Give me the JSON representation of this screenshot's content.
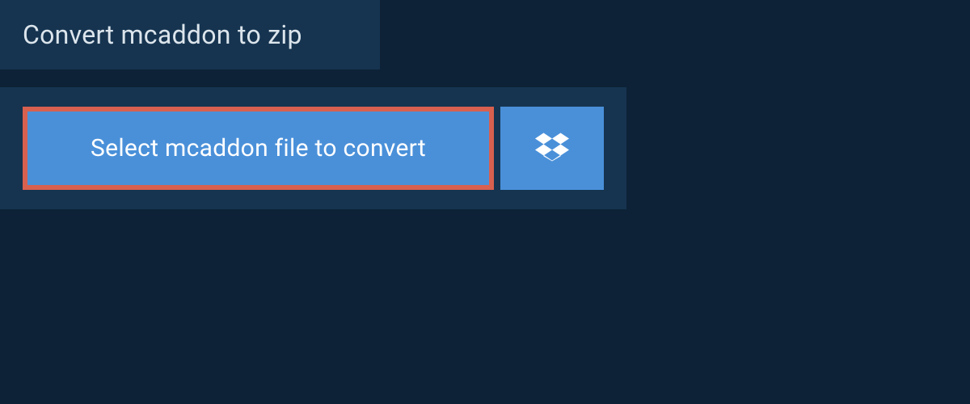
{
  "header": {
    "title": "Convert mcaddon to zip"
  },
  "upload": {
    "select_label": "Select mcaddon file to convert",
    "cloud_provider": "dropbox"
  }
}
